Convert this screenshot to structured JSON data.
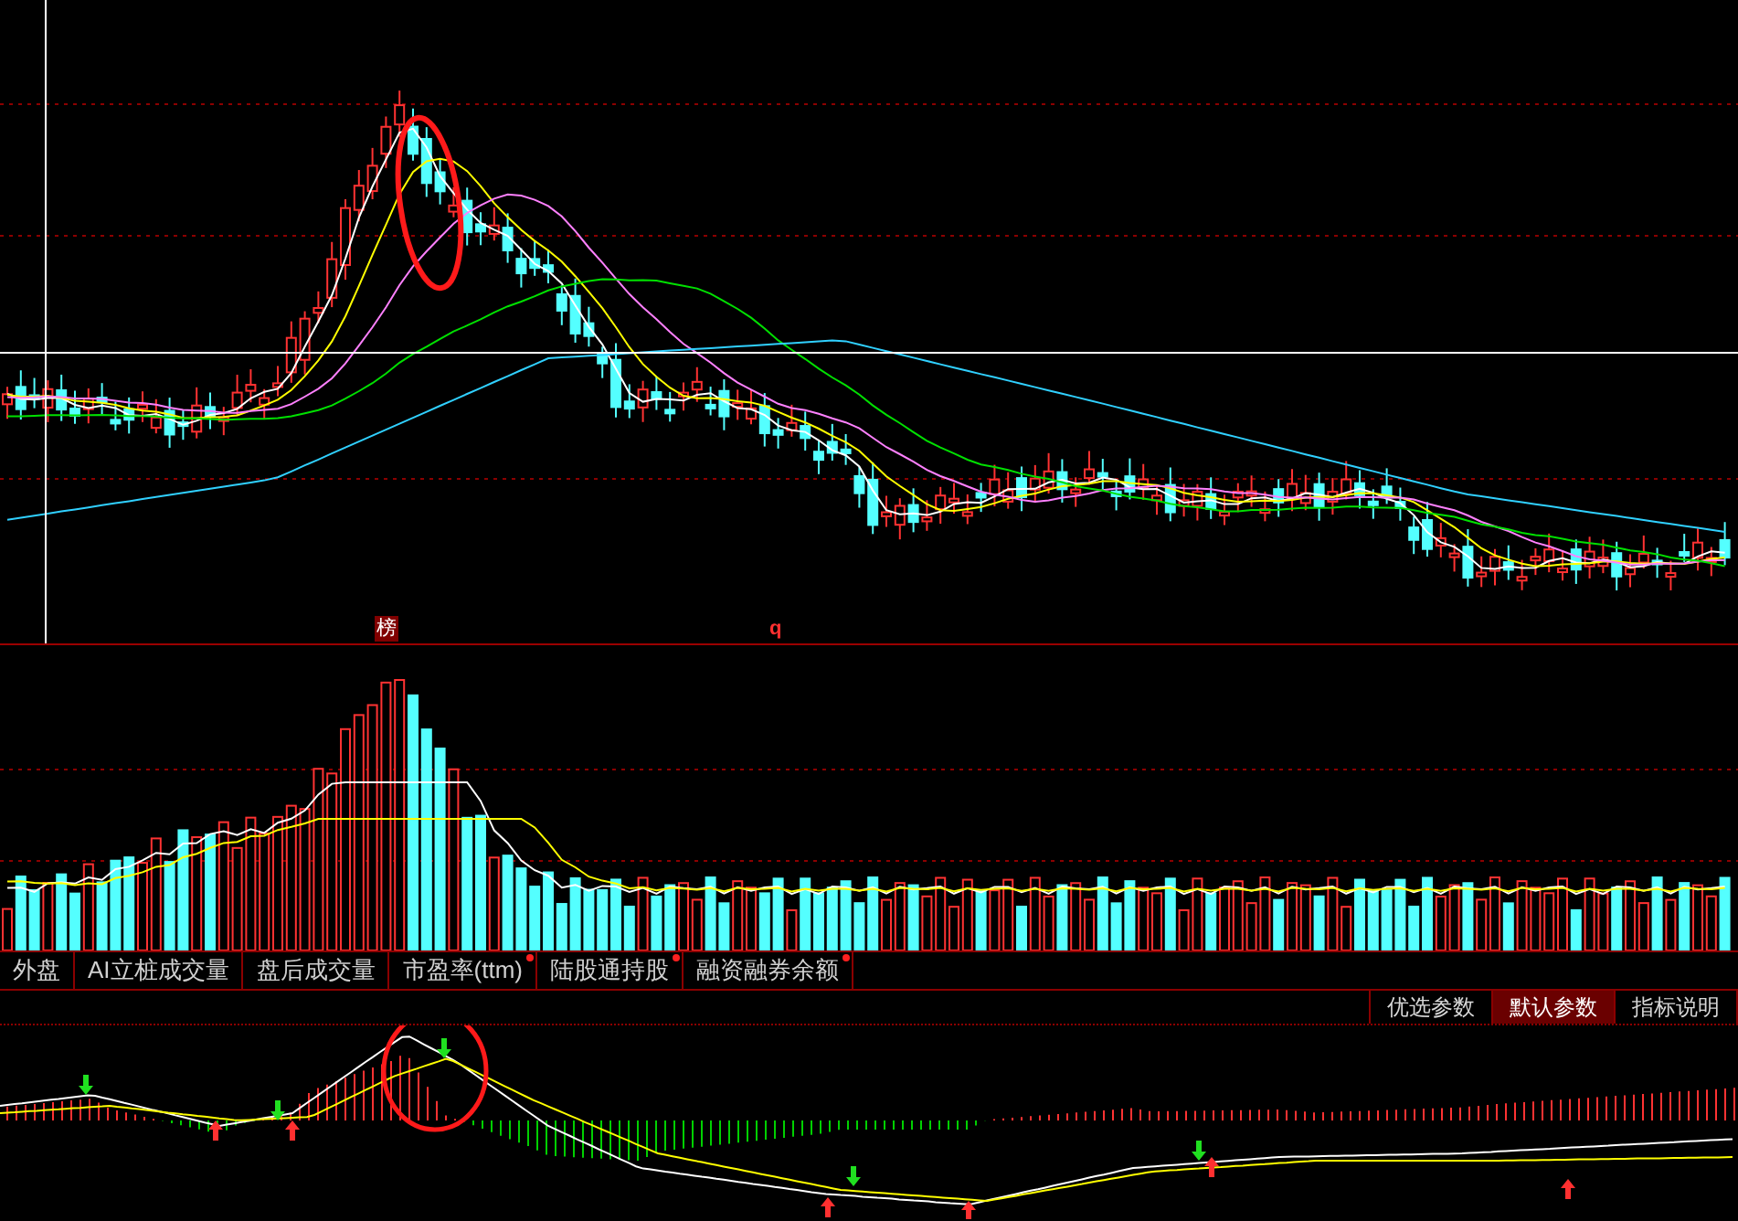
{
  "main_chart": {
    "labels": [
      {
        "text": "榜",
        "kind": "badge"
      },
      {
        "text": "q",
        "kind": "plain"
      }
    ]
  },
  "indicator_tabs": [
    {
      "label": "外盘",
      "dot": false
    },
    {
      "label": "AI立桩成交量",
      "dot": false
    },
    {
      "label": "盘后成交量",
      "dot": false
    },
    {
      "label": "市盈率(ttm)",
      "dot": true
    },
    {
      "label": "陆股通持股",
      "dot": true
    },
    {
      "label": "融资融券余额",
      "dot": true
    }
  ],
  "parameter_buttons": [
    {
      "label": "优选参数",
      "selected": false
    },
    {
      "label": "默认参数",
      "selected": true
    },
    {
      "label": "指标说明",
      "selected": false
    }
  ]
}
